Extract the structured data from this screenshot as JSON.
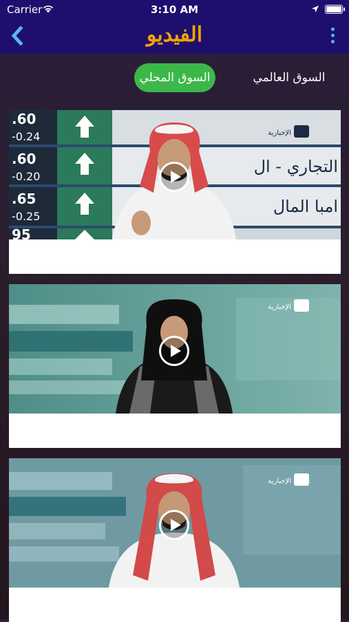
{
  "status_bar": {
    "carrier": "Carrier",
    "time": "3:10 AM"
  },
  "header": {
    "title": "الفيديو",
    "back_icon": "chevron-left-icon",
    "menu_icon": "vertical-dots-icon"
  },
  "tabs": {
    "local": "السوق المحلي",
    "global": "السوق العالمي",
    "active": "local"
  },
  "videos": [
    {
      "thumb_text_1": "التجاري - ال",
      "thumb_text_2": "امبا المال",
      "channel": "الإخبارية",
      "tickers": [
        ".60",
        "-0.24",
        ".60",
        "-0.20",
        ".65",
        "-0.25",
        "95"
      ]
    },
    {
      "channel": "الإخبارية"
    },
    {
      "channel": "الإخبارية"
    }
  ],
  "colors": {
    "navbar": "#1e0f6e",
    "title": "#f5a300",
    "active_tab": "#3cb84a",
    "icons": "#58b6f0"
  }
}
